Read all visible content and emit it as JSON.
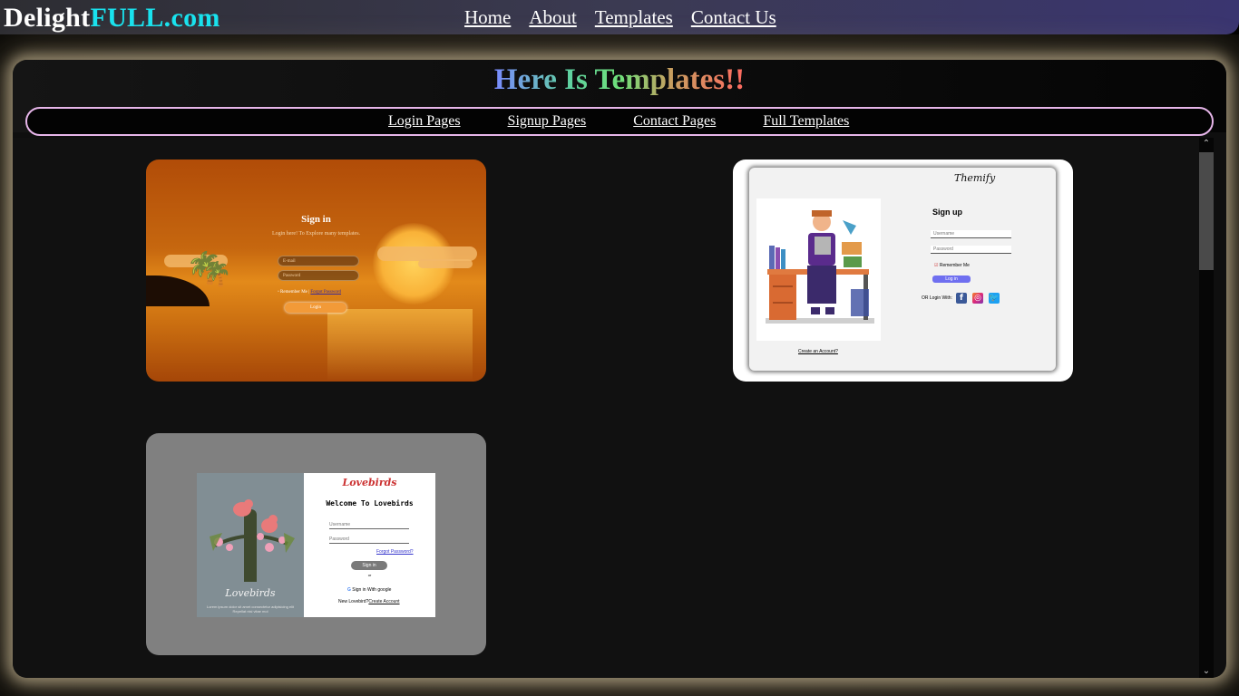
{
  "header": {
    "brand_part1": "Delight",
    "brand_part2": "FULL.com",
    "nav": [
      "Home",
      "About",
      "Templates",
      "Contact Us"
    ]
  },
  "main": {
    "heading": "Here Is Templates!!",
    "categories": [
      "Login Pages",
      "Signup Pages",
      "Contact Pages",
      "Full Templates"
    ]
  },
  "templates": {
    "sunset_login": {
      "title": "Sign in",
      "subtitle": "Login here! To Explore many templates.",
      "email_placeholder": "E-mail",
      "password_placeholder": "Password",
      "remember": "Remember Me |",
      "forgot": "Forgot Password",
      "button": "Login"
    },
    "themify_signup": {
      "brand": "Themify",
      "title": "Sign up",
      "username_placeholder": "Username",
      "password_placeholder": "Password",
      "remember": "Remember Me",
      "button": "Log in",
      "social_label": "OR Login With:",
      "create_account": "Create an Account?"
    },
    "lovebirds": {
      "brand": "Lovebirds",
      "welcome": "Welcome To Lovebirds",
      "username_placeholder": "Username",
      "password_placeholder": "Password",
      "forgot": "Forgot Password?",
      "button": "Sign in",
      "or": "or",
      "google": "Sign in With google",
      "new_prompt": "New Lovebird?",
      "create_account": "Create Account",
      "left_title": "Lovebirds",
      "left_lorem": "Lorem ipsum dolor sit amet consectetur adipisicing elit Repellat nisi vitae mol"
    }
  },
  "colors": {
    "brand_white": "#ffffff",
    "brand_cyan": "#19e3ef",
    "category_border": "#e7b6ea",
    "header_gradient_end": "#3a3570"
  }
}
